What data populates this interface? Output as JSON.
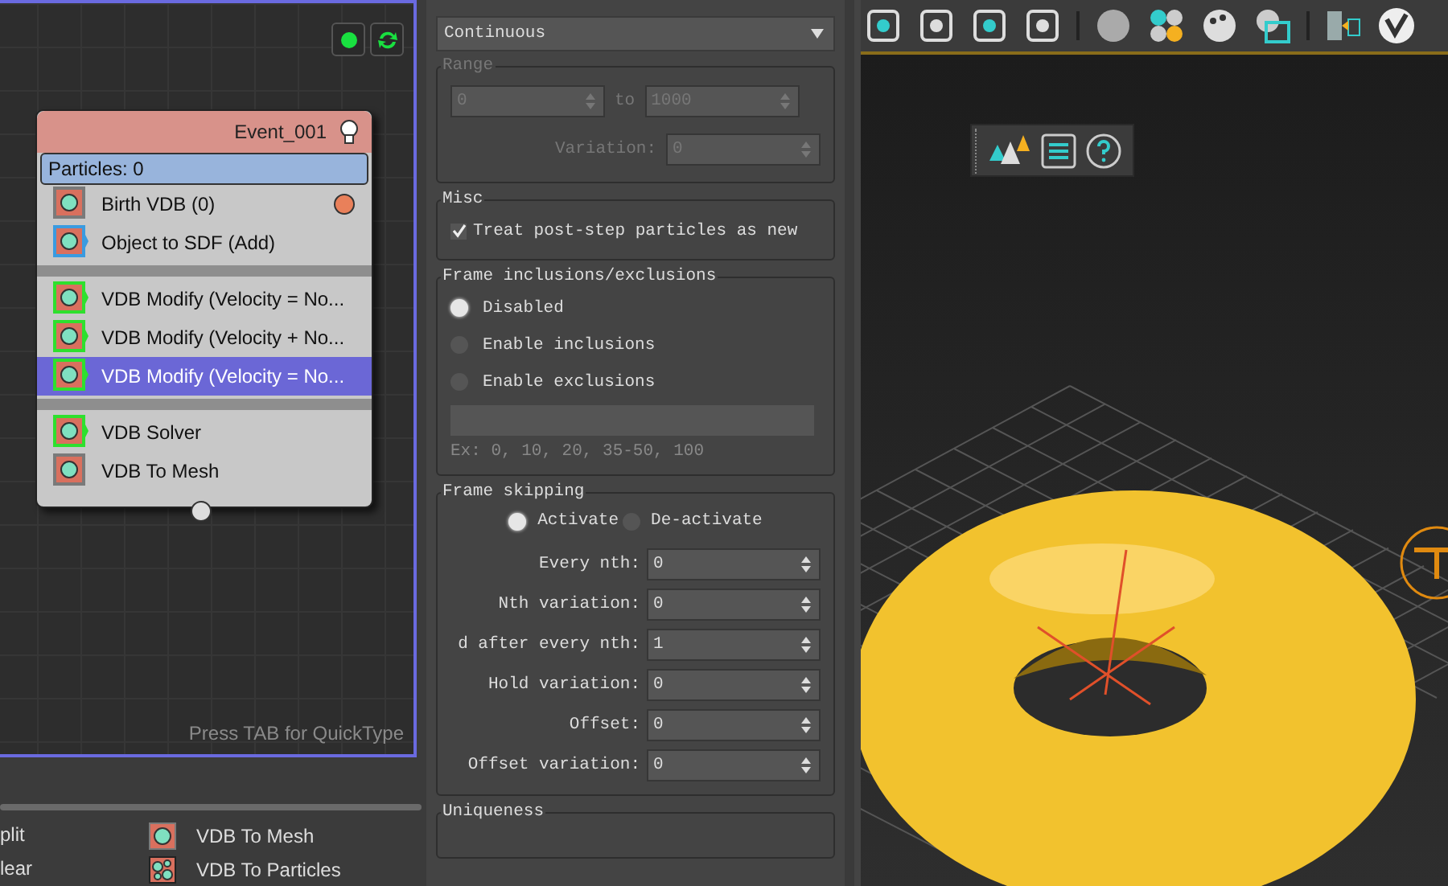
{
  "node_editor": {
    "event": {
      "title": "Event_001",
      "particles": "Particles: 0",
      "groups": [
        {
          "operators": [
            {
              "label": "Birth VDB (0)",
              "kind": "birth",
              "selected": false
            },
            {
              "label": "Object to SDF (Add)",
              "kind": "source",
              "selected": false
            }
          ]
        },
        {
          "operators": [
            {
              "label": "VDB Modify (Velocity = No...",
              "kind": "modify",
              "selected": false
            },
            {
              "label": "VDB Modify (Velocity + No...",
              "kind": "modify",
              "selected": false
            },
            {
              "label": "VDB Modify (Velocity = No...",
              "kind": "modify",
              "selected": true
            }
          ]
        },
        {
          "operators": [
            {
              "label": "VDB Solver",
              "kind": "solver",
              "selected": false
            },
            {
              "label": "VDB To Mesh",
              "kind": "mesh",
              "selected": false
            }
          ]
        }
      ]
    },
    "hint": "Press TAB for QuickType"
  },
  "operator_palette": {
    "column_1": [
      "plit",
      "lear"
    ],
    "column_2": [
      {
        "label": "VDB To Mesh",
        "kind": "mesh"
      },
      {
        "label": "VDB To Particles",
        "kind": "particles"
      }
    ]
  },
  "properties": {
    "mode_dropdown": "Continuous",
    "range": {
      "title": "Range",
      "disabled": true,
      "from": "0",
      "to_label": "to",
      "to": "1000",
      "variation_label": "Variation:",
      "variation": "0"
    },
    "misc": {
      "title": "Misc",
      "checkbox": {
        "label": "Treat post-step particles as new",
        "checked": true
      }
    },
    "frame_inclusions": {
      "title": "Frame inclusions/exclusions",
      "options": [
        {
          "label": "Disabled",
          "selected": true
        },
        {
          "label": "Enable inclusions",
          "selected": false
        },
        {
          "label": "Enable exclusions",
          "selected": false
        }
      ],
      "example": "Ex: 0, 10, 20, 35-50, 100"
    },
    "frame_skipping": {
      "title": "Frame skipping",
      "options": [
        {
          "label": "Activate",
          "selected": true
        },
        {
          "label": "De-activate",
          "selected": false
        }
      ],
      "fields": [
        {
          "label": "Every nth:",
          "value": "0"
        },
        {
          "label": "Nth variation:",
          "value": "0"
        },
        {
          "label": "d after every nth:",
          "value": "1"
        },
        {
          "label": "Hold variation:",
          "value": "0"
        },
        {
          "label": "Offset:",
          "value": "0"
        },
        {
          "label": "Offset variation:",
          "value": "0"
        }
      ]
    },
    "uniqueness": {
      "title": "Uniqueness"
    }
  }
}
